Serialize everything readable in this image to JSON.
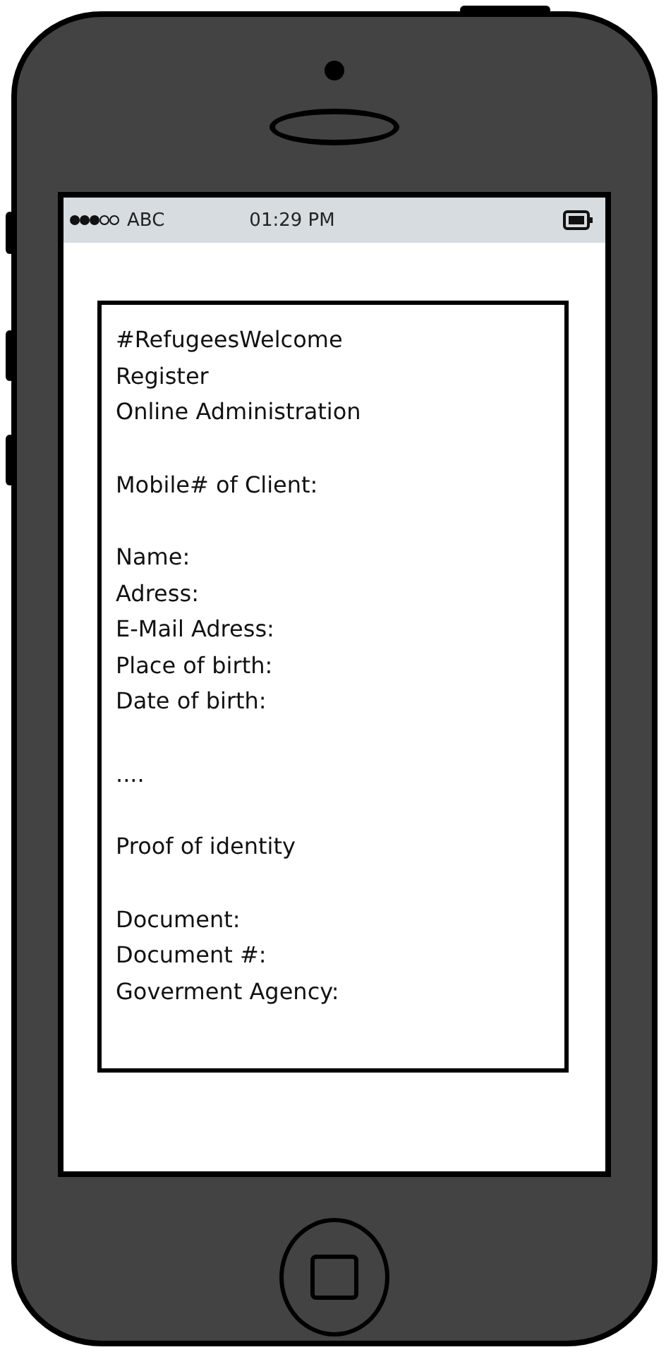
{
  "status_bar": {
    "carrier": "ABC",
    "time": "01:29 PM"
  },
  "form": {
    "groups": [
      [
        "#RefugeesWelcome",
        "Register",
        "Online Administration"
      ],
      [
        "Mobile# of Client:"
      ],
      [
        "Name:",
        "Adress:",
        "E-Mail Adress:",
        "Place of birth:",
        "Date of birth:"
      ],
      [
        "...."
      ],
      [
        "Proof of identity"
      ],
      [
        "Document:",
        "Document #:",
        "Goverment Agency:"
      ]
    ]
  }
}
